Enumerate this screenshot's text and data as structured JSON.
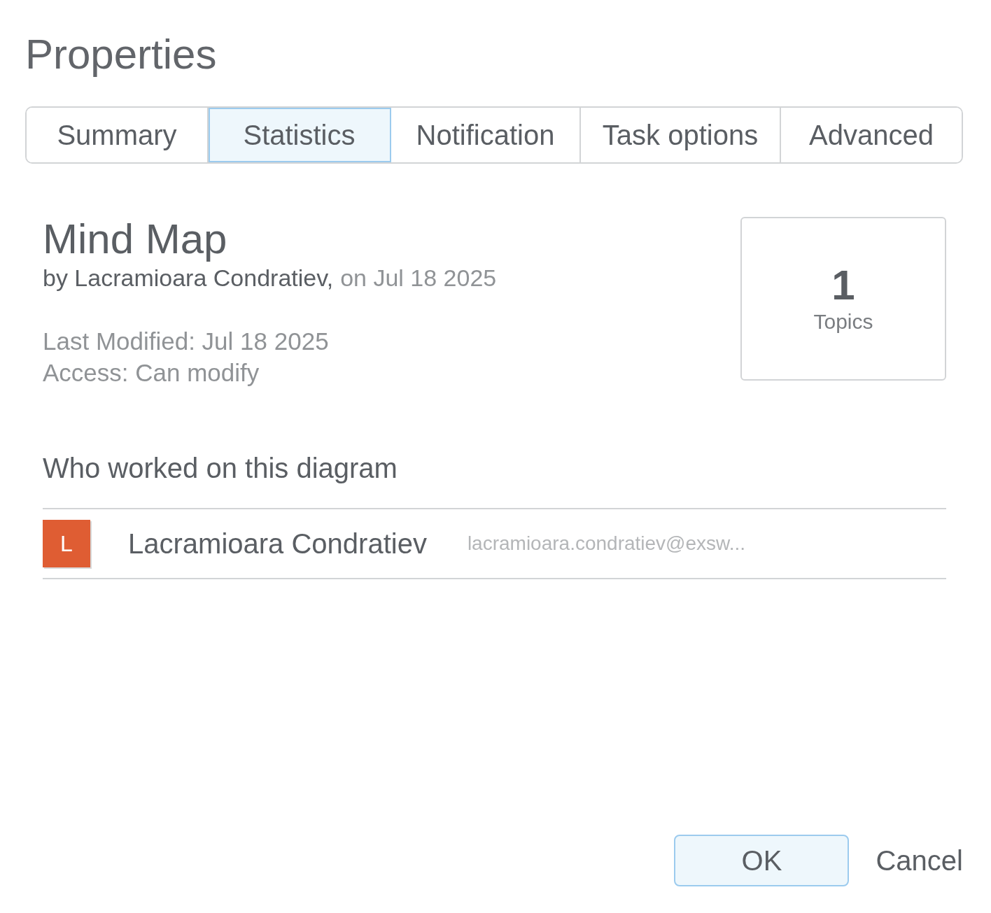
{
  "window": {
    "title": "Properties"
  },
  "tabs": [
    {
      "label": "Summary",
      "selected": false
    },
    {
      "label": "Statistics",
      "selected": true
    },
    {
      "label": "Notification",
      "selected": false
    },
    {
      "label": "Task options",
      "selected": false
    },
    {
      "label": "Advanced",
      "selected": false
    }
  ],
  "document": {
    "title": "Mind Map",
    "author": "by Lacramioara Condratiev,",
    "created": "on Jul 18 2025",
    "last_modified": "Last Modified: Jul 18 2025",
    "access": "Access: Can modify"
  },
  "stats": {
    "value": "1",
    "label": "Topics"
  },
  "contributors": {
    "heading": "Who worked on this diagram",
    "people": [
      {
        "initial": "L",
        "color": "#df5d33",
        "name": "Lacramioara Condratiev",
        "email": "lacramioara.condratiev@exsw..."
      }
    ]
  },
  "buttons": [
    {
      "label": "OK",
      "kind": "primary"
    },
    {
      "label": "Cancel",
      "kind": "plain"
    }
  ]
}
